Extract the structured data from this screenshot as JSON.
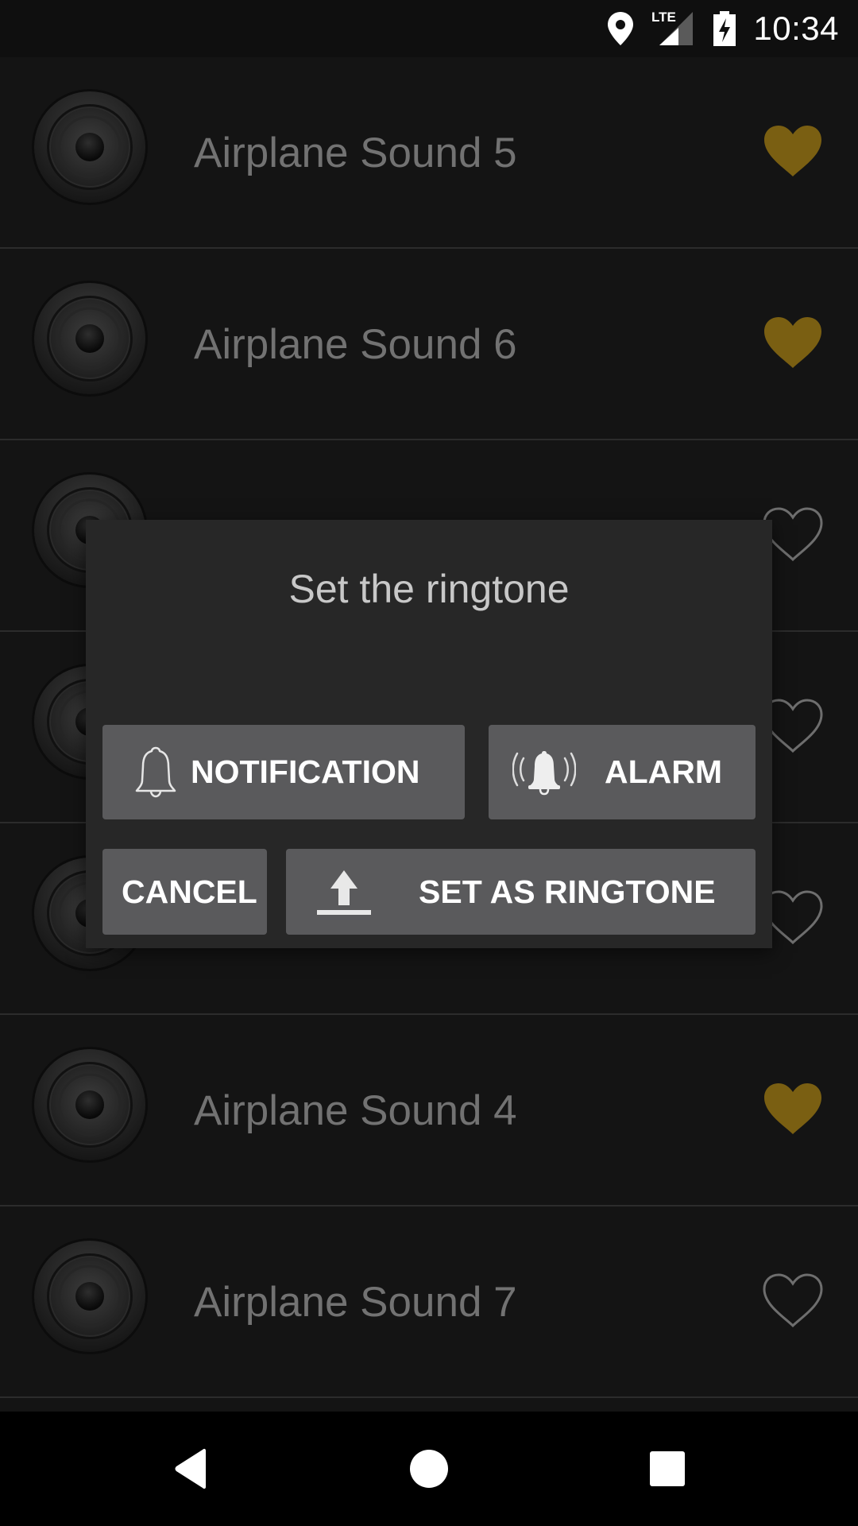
{
  "status_bar": {
    "time": "10:34",
    "network_label": "LTE",
    "icons": [
      "location-icon",
      "lte-signal-icon",
      "battery-charging-icon"
    ]
  },
  "list": {
    "items": [
      {
        "title": "Airplane Sound 5",
        "favorite": true
      },
      {
        "title": "Airplane Sound 6",
        "favorite": true
      },
      {
        "title": "",
        "favorite": false
      },
      {
        "title": "",
        "favorite": false
      },
      {
        "title": "",
        "favorite": false
      },
      {
        "title": "Airplane Sound 4",
        "favorite": true
      },
      {
        "title": "Airplane Sound 7",
        "favorite": false
      }
    ]
  },
  "dialog": {
    "title": "Set the ringtone",
    "buttons": {
      "notification": {
        "label": "NOTIFICATION",
        "icon": "bell-outline-icon"
      },
      "alarm": {
        "label": "ALARM",
        "icon": "ringing-bell-icon"
      },
      "cancel": {
        "label": "CANCEL"
      },
      "set_ringtone": {
        "label": "SET AS RINGTONE",
        "icon": "upload-icon"
      }
    }
  },
  "nav_bar": {
    "buttons": [
      "back-icon",
      "home-icon",
      "recents-icon"
    ]
  },
  "colors": {
    "favorite_fill": "#7a5f12",
    "favorite_outline": "#6e6e6e",
    "button_bg": "#5a5a5c",
    "dialog_bg": "#272727"
  }
}
